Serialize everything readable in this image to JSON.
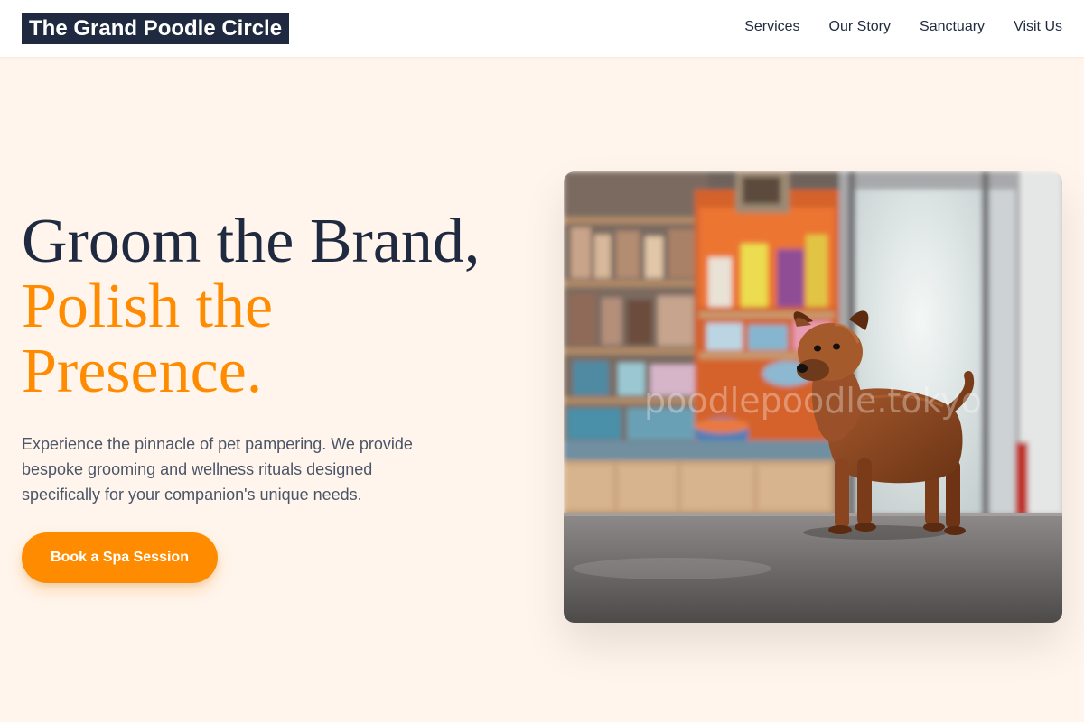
{
  "brand": {
    "name": "The Grand Poodle Circle"
  },
  "nav": {
    "links": [
      "Services",
      "Our Story",
      "Sanctuary",
      "Visit Us"
    ]
  },
  "hero": {
    "headline_line1": "Groom the Brand,",
    "headline_accent": "Polish the Presence.",
    "subtext": "Experience the pinnacle of pet pampering. We provide bespoke grooming and wellness rituals designed specifically for your companion's unique needs.",
    "cta_label": "Book a Spa Session"
  },
  "image": {
    "subject": "small brown dog standing in a pet shop",
    "watermark": "poodlepoodle.tokyo"
  },
  "colors": {
    "page_bg": "#fff5ec",
    "navy": "#1f2a40",
    "accent": "#ff8c00",
    "body_text": "#4a5568"
  }
}
